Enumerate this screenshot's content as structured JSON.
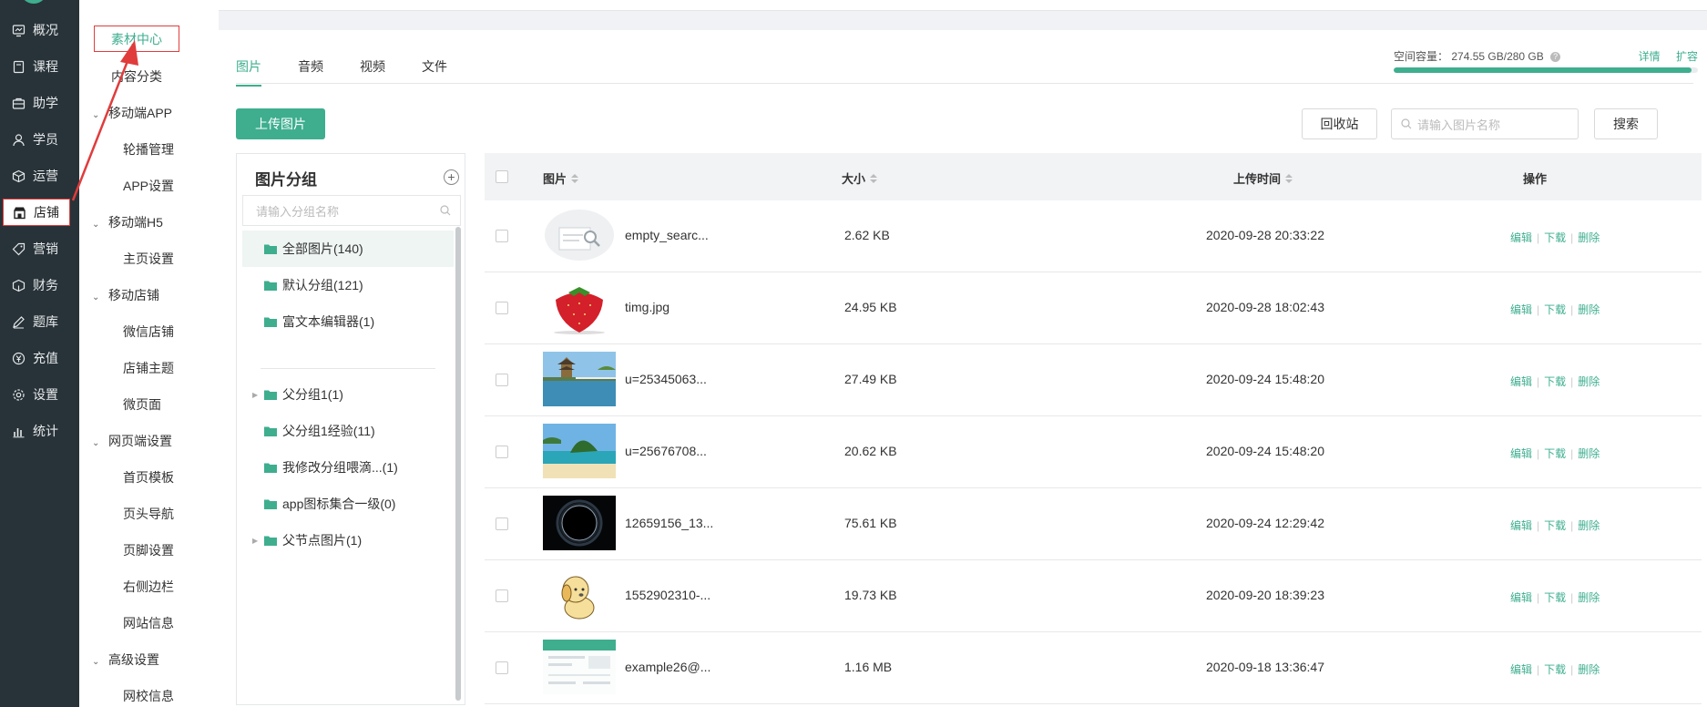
{
  "sidebar": {
    "items": [
      {
        "label": "概况",
        "icon": "monitor-icon"
      },
      {
        "label": "课程",
        "icon": "book-icon"
      },
      {
        "label": "助学",
        "icon": "briefcase-icon"
      },
      {
        "label": "学员",
        "icon": "user-icon"
      },
      {
        "label": "运营",
        "icon": "cube-icon"
      },
      {
        "label": "店铺",
        "icon": "store-icon"
      },
      {
        "label": "营销",
        "icon": "tag-icon"
      },
      {
        "label": "财务",
        "icon": "box-icon"
      },
      {
        "label": "题库",
        "icon": "pen-icon"
      },
      {
        "label": "充值",
        "icon": "yen-icon"
      },
      {
        "label": "设置",
        "icon": "gear-icon"
      },
      {
        "label": "统计",
        "icon": "bar-chart-icon"
      }
    ],
    "active": "店铺"
  },
  "submenu": {
    "active": "素材中心",
    "content_category": "内容分类",
    "mobile_app": {
      "label": "移动端APP",
      "items": [
        "轮播管理",
        "APP设置"
      ]
    },
    "mobile_h5": {
      "label": "移动端H5",
      "items": [
        "主页设置"
      ]
    },
    "mobile_store": {
      "label": "移动店铺",
      "items": [
        "微信店铺",
        "店铺主题",
        "微页面"
      ]
    },
    "web_settings": {
      "label": "网页端设置",
      "items": [
        "首页模板",
        "页头导航",
        "页脚设置",
        "右侧边栏",
        "网站信息"
      ]
    },
    "advanced": {
      "label": "高级设置",
      "items": [
        "网校信息"
      ]
    }
  },
  "tabs": [
    "图片",
    "音频",
    "视频",
    "文件"
  ],
  "active_tab": "图片",
  "quota": {
    "label": "空间容量：",
    "value": "274.55 GB/280 GB",
    "used_fraction": 0.98,
    "detail": "详情",
    "expand": "扩容"
  },
  "toolbar": {
    "upload": "上传图片",
    "recycle": "回收站",
    "search_placeholder": "请输入图片名称",
    "search": "搜索"
  },
  "groups": {
    "title": "图片分组",
    "search_placeholder": "请输入分组名称",
    "items": [
      {
        "label": "全部图片(140)",
        "active": true,
        "expandable": false
      },
      {
        "label": "默认分组(121)",
        "active": false,
        "expandable": false
      },
      {
        "label": "富文本编辑器(1)",
        "active": false,
        "expandable": false
      },
      {
        "label": "父分组1(1)",
        "active": false,
        "expandable": true
      },
      {
        "label": "父分组1经验(11)",
        "active": false,
        "expandable": false
      },
      {
        "label": "我修改分组喂滴...(1)",
        "active": false,
        "expandable": false
      },
      {
        "label": "app图标集合一级(0)",
        "active": false,
        "expandable": false
      },
      {
        "label": "父节点图片(1)",
        "active": false,
        "expandable": true
      }
    ]
  },
  "table": {
    "headers": {
      "image": "图片",
      "size": "大小",
      "time": "上传时间",
      "ops": "操作"
    },
    "ops": {
      "edit": "编辑",
      "download": "下载",
      "delete": "删除"
    },
    "rows": [
      {
        "name": "empty_searc...",
        "size": "2.62 KB",
        "time": "2020-09-28 20:33:22",
        "thumb": "empty-search"
      },
      {
        "name": "timg.jpg",
        "size": "24.95 KB",
        "time": "2020-09-28 18:02:43",
        "thumb": "strawberry"
      },
      {
        "name": "u=25345063...",
        "size": "27.49 KB",
        "time": "2020-09-24 15:48:20",
        "thumb": "pagoda"
      },
      {
        "name": "u=25676708...",
        "size": "20.62 KB",
        "time": "2020-09-24 15:48:20",
        "thumb": "island"
      },
      {
        "name": "12659156_13...",
        "size": "75.61 KB",
        "time": "2020-09-24 12:29:42",
        "thumb": "eclipse"
      },
      {
        "name": "1552902310-...",
        "size": "19.73 KB",
        "time": "2020-09-20 18:39:23",
        "thumb": "puppy"
      },
      {
        "name": "example26@...",
        "size": "1.16 MB",
        "time": "2020-09-18 13:36:47",
        "thumb": "screenshot"
      }
    ]
  }
}
